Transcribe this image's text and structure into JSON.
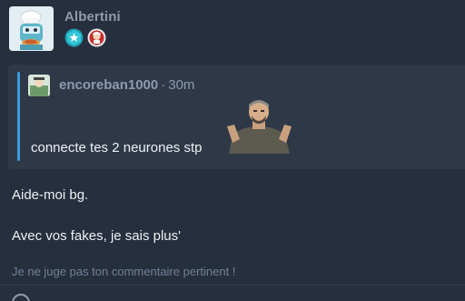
{
  "post": {
    "author": "Albertini",
    "avatar_icon": "mascot-chef-avatar-icon",
    "badges": [
      {
        "name": "star-badge-icon",
        "color": "#29b6c8"
      },
      {
        "name": "character-badge-icon",
        "color": "#c0392b"
      }
    ]
  },
  "quote": {
    "user": "encoreban1000",
    "separator": "·",
    "time": "30m",
    "text": "connecte tes 2 neurones stp",
    "accent_color": "#3a9be0",
    "sticker_icon": "bearded-man-sticker-icon"
  },
  "message": {
    "line1": "Aide-moi bg.",
    "line2": "Avec vos fakes, je sais plus'"
  },
  "signature": "Je ne juge pas ton commentaire pertinent !"
}
